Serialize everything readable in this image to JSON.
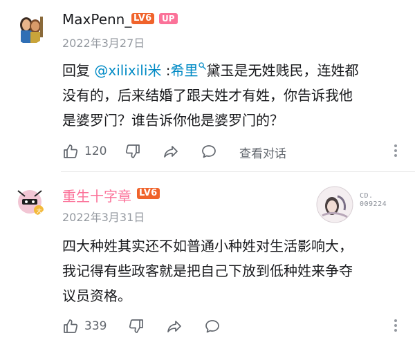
{
  "comments": [
    {
      "username": "MaxPenn_",
      "level": "LV6",
      "up_badge": "UP",
      "date": "2022年3月27日",
      "content": {
        "reply_prefix": "回复 ",
        "mention": "@xilixili米",
        "separator": " :",
        "keyword": "希里",
        "lines": [
          "黛玉是无姓贱民，连姓都",
          "没有的，后来结婚了跟夫姓才有姓，你告诉我他",
          "是婆罗门？谁告诉你他是婆罗门的？"
        ]
      },
      "likes": "120",
      "view_conversation": "查看对话"
    },
    {
      "username": "重生十字章",
      "level": "LV6",
      "date": "2022年3月31日",
      "fan_badge_number": [
        "CD.",
        "009224"
      ],
      "content": {
        "lines": [
          "四大种姓其实还不如普通小种姓对生活影响大，",
          "我记得有些政客就是把自己下放到低种姓来争夺",
          "议员资格。"
        ]
      },
      "likes": "339"
    }
  ],
  "colors": {
    "username_default": "#18191c",
    "username_vip": "#fb7299",
    "mention": "#008ac5",
    "level_badge": "#f0632b",
    "up_badge": "#fb7299",
    "meta_text": "#9499a0"
  },
  "icons": [
    "like-icon",
    "dislike-icon",
    "share-icon",
    "reply-icon",
    "more-icon",
    "search-icon"
  ]
}
